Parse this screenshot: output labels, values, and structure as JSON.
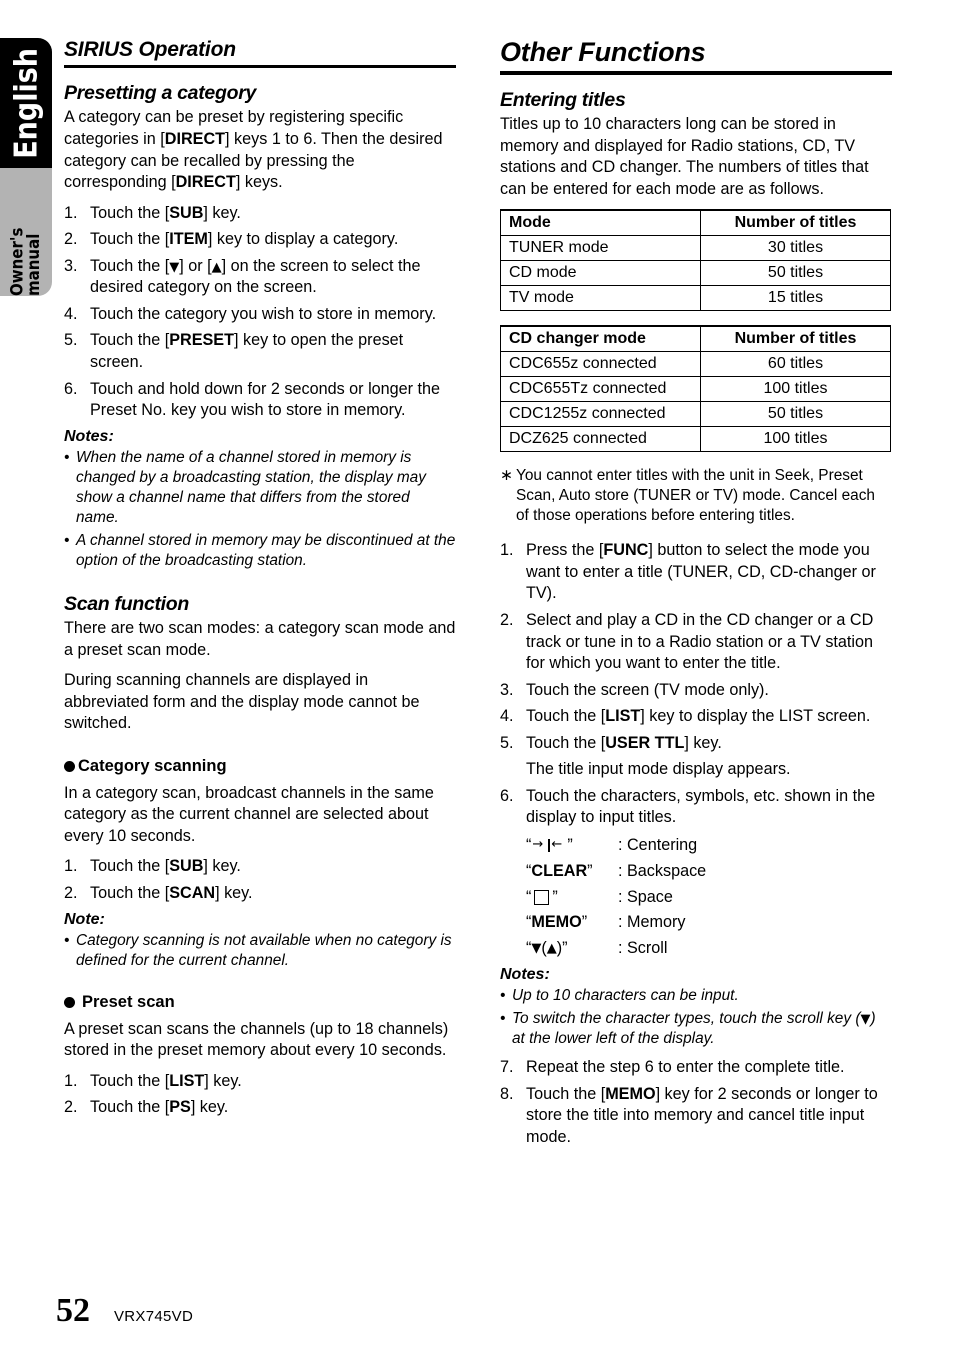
{
  "side_tab": {
    "language": "English",
    "manual_type": "Owner's manual",
    "black_color": "#000000",
    "grey_color": "#b3b3b3"
  },
  "left_column": {
    "chapter_title": "SIRIUS Operation",
    "presetting": {
      "heading": "Presetting a category",
      "intro": "A category can be preset by registering specific categories in [DIRECT] keys 1 to 6. Then the desired category can be recalled by pressing the corresponding [DIRECT] keys.",
      "steps": [
        "Touch the [SUB] key.",
        "Touch the [ITEM] key to display a category.",
        "Touch the [▼] or [▲] on the screen to select the desired category on the screen.",
        "Touch the category you wish to store in memory.",
        "Touch the [PRESET] key to open the preset screen.",
        "Touch and hold down for 2 seconds or longer the Preset No. key you wish to store in memory."
      ],
      "notes_label": "Notes:",
      "notes": [
        "When the name of a channel stored in memory is changed by a broadcasting station, the display may show a channel name that differs from the stored name.",
        "A channel stored in memory may be discontinued at the option of the broadcasting station."
      ]
    },
    "scan": {
      "heading": "Scan function",
      "para1": "There are two scan modes: a category scan mode and a preset scan mode.",
      "para2": "During scanning channels are displayed in abbreviated form and the display mode cannot be switched.",
      "category_scanning": {
        "heading": "Category scanning",
        "para": "In a category scan, broadcast channels in the same category as the current channel are selected about every 10 seconds.",
        "steps": [
          "Touch the [SUB] key.",
          "Touch the [SCAN] key."
        ],
        "note_label": "Note:",
        "notes": [
          "Category scanning is not available when no category is defined for the current channel."
        ]
      },
      "preset_scan": {
        "heading": "Preset scan",
        "para": "A preset scan scans the channels (up to 18 channels) stored in the preset memory about every 10 seconds.",
        "steps": [
          "Touch the [LIST] key.",
          "Touch the [PS] key."
        ]
      }
    }
  },
  "right_column": {
    "chapter_title": "Other Functions",
    "entering_titles": {
      "heading": "Entering titles",
      "intro": "Titles up to 10 characters long can be stored in memory and displayed for Radio stations, CD, TV stations and CD changer. The numbers of titles that can be entered for each mode are as follows.",
      "table_mode": {
        "headers": [
          "Mode",
          "Number of titles"
        ],
        "rows": [
          [
            "TUNER mode",
            "30 titles"
          ],
          [
            "CD mode",
            "50 titles"
          ],
          [
            "TV mode",
            "15 titles"
          ]
        ]
      },
      "table_changer": {
        "headers": [
          "CD changer mode",
          "Number of titles"
        ],
        "rows": [
          [
            "CDC655z connected",
            "60 titles"
          ],
          [
            "CDC655Tz connected",
            "100 titles"
          ],
          [
            "CDC1255z connected",
            "50 titles"
          ],
          [
            "DCZ625 connected",
            "100 titles"
          ]
        ]
      },
      "star_marker": "∗",
      "star_note": "You cannot enter titles with the unit in Seek, Preset Scan, Auto store (TUNER or TV) mode. Cancel each of those operations before entering titles.",
      "steps": [
        "Press the [FUNC] button to select the mode you want to enter a title (TUNER, CD, CD-changer or TV).",
        "Select and play a CD in the CD changer or a CD track or tune in to a Radio station or a TV station for which you want to enter the title.",
        "Touch the screen (TV mode only).",
        "Touch the [LIST] key to display the LIST screen.",
        "Touch the [USER TTL] key.",
        "Touch the characters, symbols, etc. shown in the display to input titles."
      ],
      "step5_sub": "The title input mode display appears.",
      "legend": [
        {
          "symbol": "“→|←”",
          "symbol_kind": "centering-arrows",
          "desc": ": Centering"
        },
        {
          "symbol": "“CLEAR”",
          "symbol_kind": "bold-text",
          "desc": ": Backspace"
        },
        {
          "symbol": "“ □ ”",
          "symbol_kind": "open-square",
          "desc": ": Space"
        },
        {
          "symbol": "“MEMO”",
          "symbol_kind": "bold-text",
          "desc": ": Memory"
        },
        {
          "symbol": "“▼(▲)”",
          "symbol_kind": "triangles",
          "desc": ": Scroll"
        }
      ],
      "notes_label": "Notes:",
      "notes": [
        "Up to 10 characters can be input.",
        "To switch the character types, touch the scroll key (▼) at the lower left of the display."
      ],
      "steps_tail": [
        "Repeat the step 6 to enter the complete title.",
        "Touch the [MEMO] key for 2 seconds or longer to store the title into memory and cancel title input mode."
      ]
    }
  },
  "footer": {
    "page_number": "52",
    "model": "VRX745VD"
  }
}
